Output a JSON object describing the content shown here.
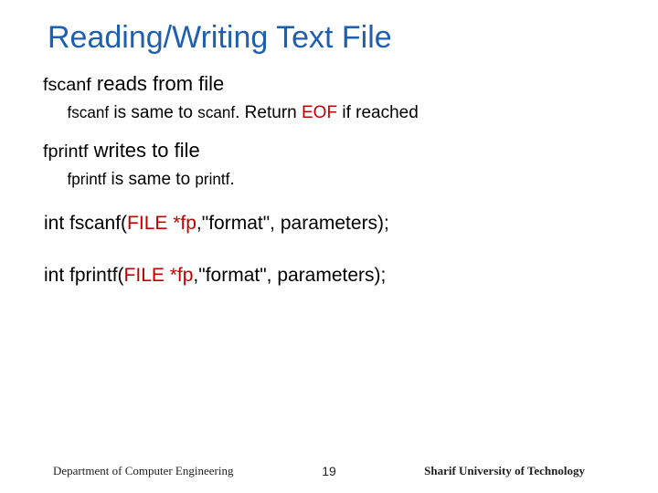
{
  "title": "Reading/Writing Text File",
  "bullets": {
    "b1_prefix": "fscanf",
    "b1_rest": " reads from file",
    "b1a_prefix": "fscanf",
    "b1a_mid": " is same to ",
    "b1a_scanf": "scanf",
    "b1a_ret": ". Return ",
    "b1a_eof": "EOF",
    "b1a_tail": " if reached",
    "b2_prefix": "fprintf",
    "b2_rest": " writes to file",
    "b2a_prefix": "fprintf",
    "b2a_mid": " is same to ",
    "b2a_printf": "printf",
    "b2a_tail": "."
  },
  "code": {
    "l1_a": "int fscanf(",
    "l1_fp": "FILE *fp",
    "l1_b": ",\"format\", parameters);",
    "l2_a": "int fprintf(",
    "l2_fp": "FILE *fp",
    "l2_b": ",\"format\", parameters);"
  },
  "footer": {
    "left": "Department of Computer Engineering",
    "page": "19",
    "right": "Sharif University of Technology"
  }
}
